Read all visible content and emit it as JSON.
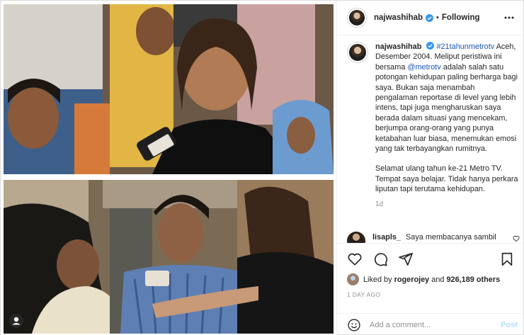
{
  "header": {
    "username": "najwashihab",
    "separator": "•",
    "follow_status": "Following"
  },
  "caption": {
    "username": "najwashihab",
    "hashtag": "#21tahunmetrotv",
    "p1_a": "Aceh, Desember 2004.  Meliput peristiwa ini bersama ",
    "mention": "@metrotv",
    "p1_b": " adalah salah satu potongan kehidupan paling berharga bagi saya. Bukan saja menambah pengalaman reportase di level yang lebih intens, tapi juga mengharuskan saya berada dalam situasi yang mencekam, berjumpa orang-orang yang punya ketabahan luar biasa, menemukan emosi yang tak terbayangkan rumitnya.",
    "p2": "Selamat ulang tahun ke-21 Metro TV. Tempat saya belajar. Tidak hanya perkara liputan tapi terutama kehidupan.",
    "time": "1d"
  },
  "comment": {
    "username": "lisapls_",
    "text": "Saya membacanya sambil"
  },
  "likes": {
    "prefix": "Liked by",
    "user": "rogerojey",
    "and": "and",
    "count": "926,189 others"
  },
  "post_date": "1 DAY AGO",
  "add_comment": {
    "placeholder": "Add a comment...",
    "post_label": "Post"
  },
  "icons": {
    "verified": "verified-badge-icon",
    "more": "more-options-icon",
    "heart": "heart-icon",
    "comment": "comment-icon",
    "share": "share-icon",
    "save": "bookmark-icon",
    "emoji": "emoji-icon",
    "user_tag": "user-tag-icon"
  },
  "colors": {
    "link": "#1b54b9",
    "verified": "#3897f0",
    "muted": "#8e8e8e",
    "post_button_disabled": "#b2dffc"
  }
}
